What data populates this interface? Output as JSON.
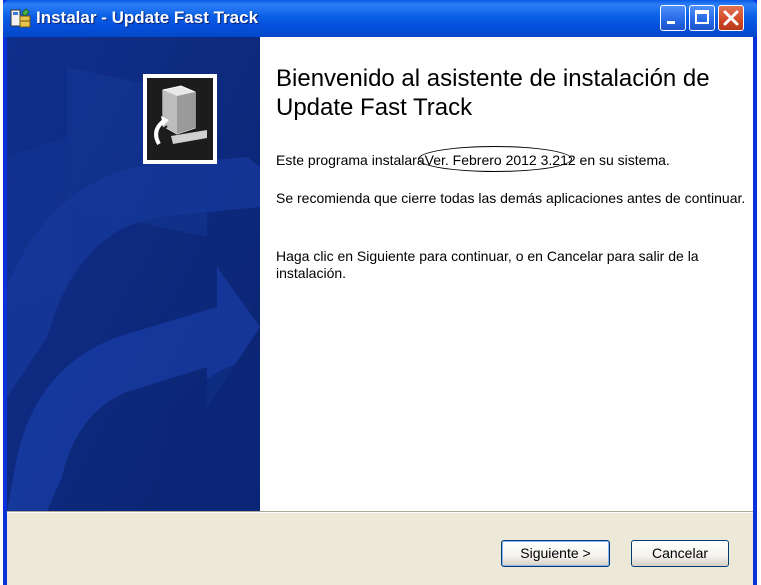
{
  "window": {
    "title": "Instalar - Update Fast Track",
    "app_icon": "installer-icon",
    "controls": [
      "minimize-icon",
      "maximize-icon",
      "close-icon"
    ]
  },
  "wizard": {
    "heading": "Bienvenido al asistente de instalación de Update Fast Track",
    "p1_before": "Este programa instalará",
    "p1_version": "Ver. Febrero 2012 3.212 en su",
    "p1_after": "sistema.",
    "p2": "Se recomienda que cierre todas las demás aplicaciones antes de continuar.",
    "p3": "Haga clic en Siguiente para continuar, o en Cancelar para salir de la instalación."
  },
  "buttons": {
    "next": "Siguiente >",
    "cancel": "Cancelar"
  },
  "colors": {
    "titlebar": "#0a5fe6",
    "sidebar": "#0e2d85",
    "dialog_bg": "#ece9d8"
  }
}
